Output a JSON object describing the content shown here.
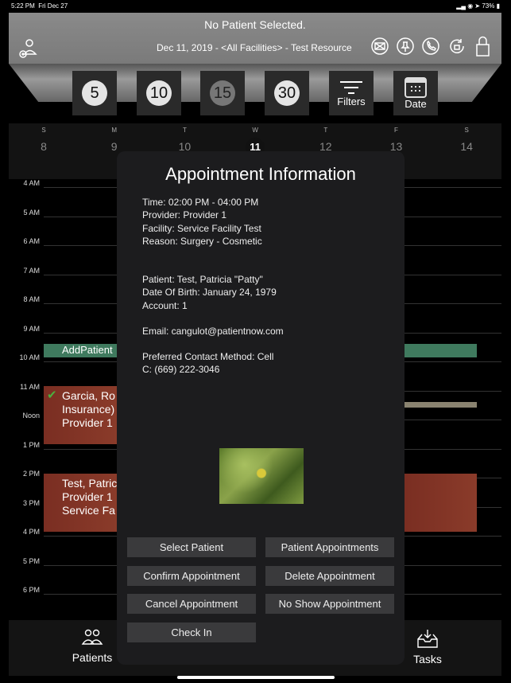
{
  "status": {
    "time": "5:22 PM",
    "date": "Fri Dec 27",
    "battery": "73%"
  },
  "header": {
    "patient": "No Patient Selected.",
    "context": "Dec 11, 2019 - <All Facilities> - Test Resource"
  },
  "toolbar": {
    "intervals": [
      "5",
      "10",
      "15",
      "30"
    ],
    "selected_interval": "15",
    "filters": "Filters",
    "date": "Date"
  },
  "week": {
    "days": [
      {
        "l": "S",
        "n": "8"
      },
      {
        "l": "M",
        "n": "9"
      },
      {
        "l": "T",
        "n": "10"
      },
      {
        "l": "W",
        "n": "11"
      },
      {
        "l": "T",
        "n": "12"
      },
      {
        "l": "F",
        "n": "13"
      },
      {
        "l": "S",
        "n": "14"
      }
    ],
    "selected": "11"
  },
  "hours": [
    "4 AM",
    "5 AM",
    "6 AM",
    "7 AM",
    "8 AM",
    "9 AM",
    "10 AM",
    "11 AM",
    "Noon",
    "1 PM",
    "2 PM",
    "3 PM",
    "4 PM",
    "5 PM",
    "6 PM"
  ],
  "events": {
    "add_patient": "AddPatient",
    "garcia": [
      "Garcia, Ro",
      "Insurance)",
      "Provider 1"
    ],
    "test": [
      "Test, Patric",
      "Provider 1",
      "Service  Fa"
    ]
  },
  "modal": {
    "title": "Appointment Information",
    "lines1": [
      "Time: 02:00 PM - 04:00 PM",
      "Provider: Provider 1",
      "Facility: Service  Facility Test",
      "Reason: Surgery - Cosmetic"
    ],
    "lines2": [
      "Patient: Test, Patricia \"Patty\"",
      "Date Of Birth: January 24, 1979",
      "Account: 1"
    ],
    "email": "Email: cangulot@patientnow.com",
    "lines3": [
      "Preferred Contact Method: Cell",
      "C: (669) 222-3046"
    ],
    "buttons": [
      "Select Patient",
      "Patient Appointments",
      "Confirm Appointment",
      "Delete Appointment",
      "Cancel Appointment",
      "No Show Appointment",
      "Check In"
    ]
  },
  "tabs": {
    "patients": "Patients",
    "tasks": "Tasks"
  },
  "colors": {
    "event_red": "#8a3b2a",
    "event_green": "#3f7a5e",
    "event_tan": "#8a8370",
    "check_green": "#4caf3f"
  }
}
